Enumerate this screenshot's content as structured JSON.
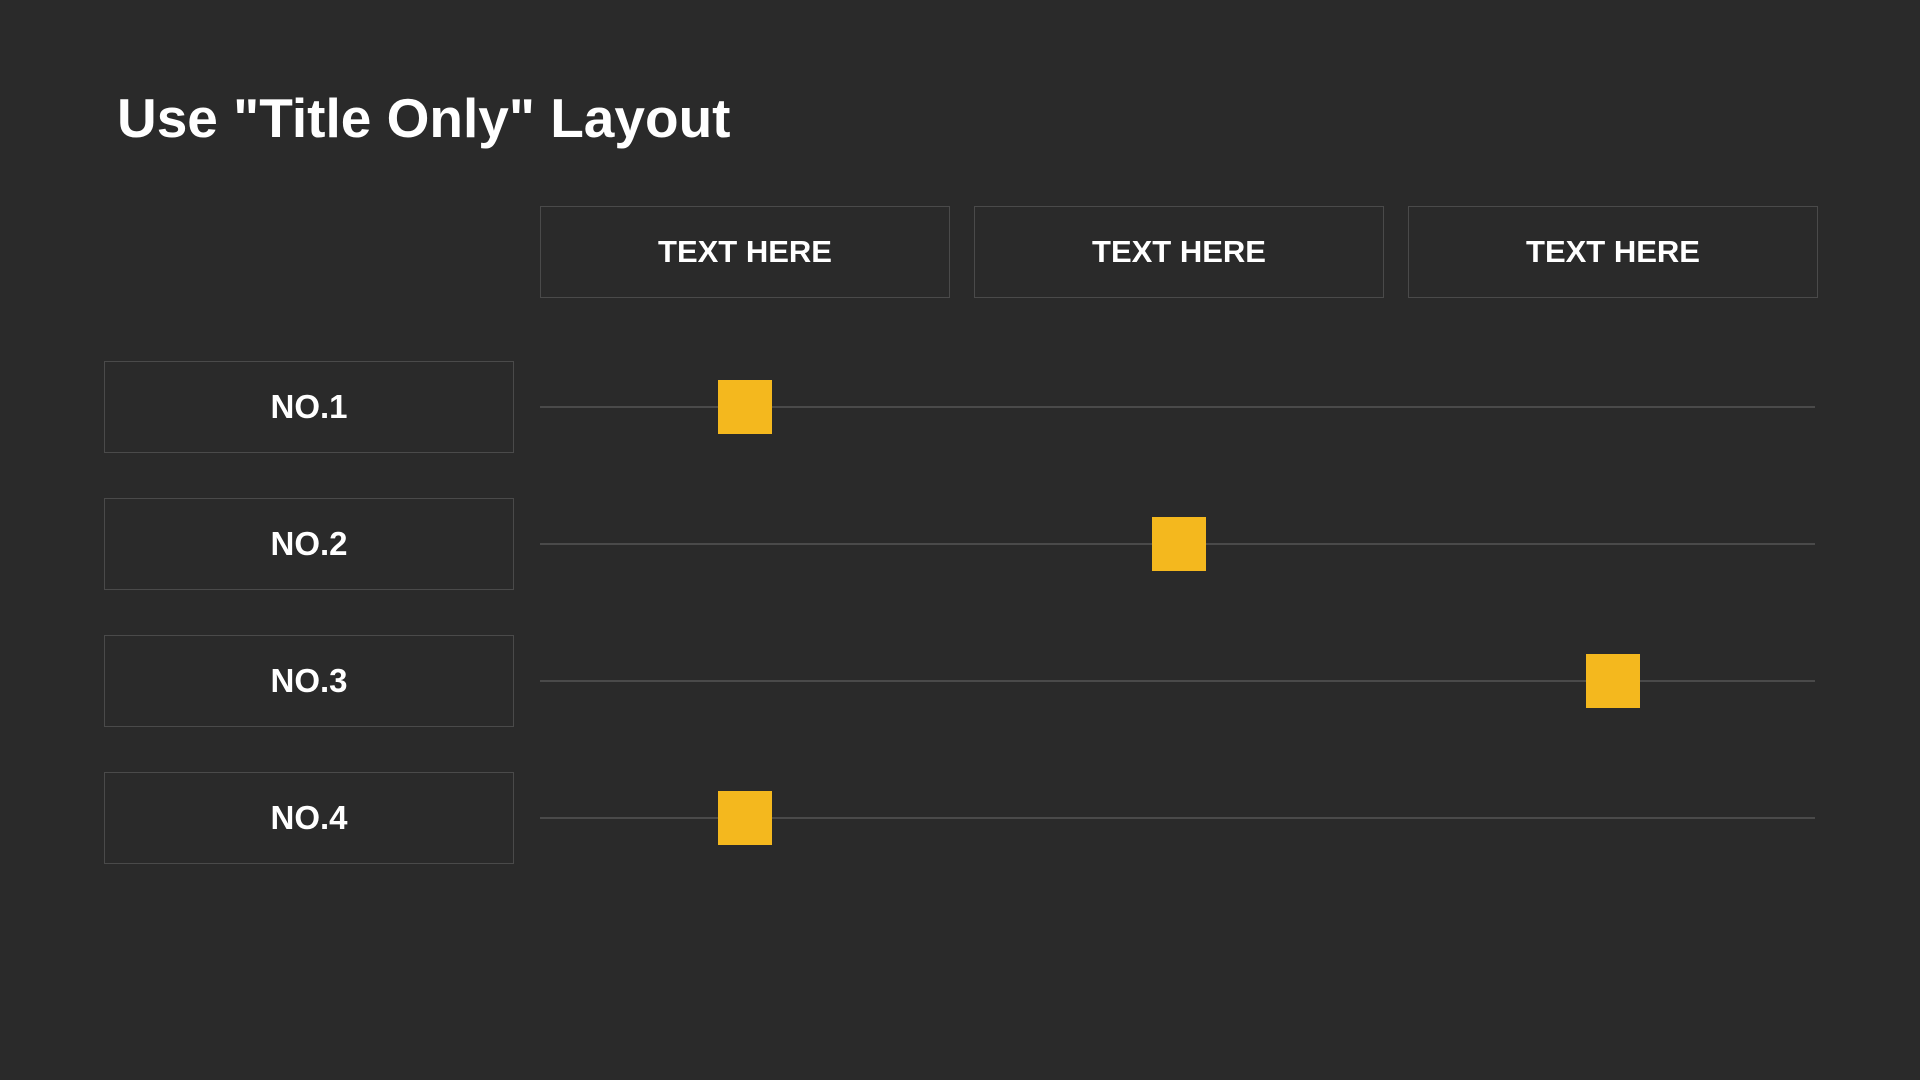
{
  "title": "Use \"Title Only\" Layout",
  "columns": [
    {
      "label": "TEXT HERE"
    },
    {
      "label": "TEXT HERE"
    },
    {
      "label": "TEXT HERE"
    }
  ],
  "rows": [
    {
      "label": "NO.1",
      "marker_col": 0
    },
    {
      "label": "NO.2",
      "marker_col": 1
    },
    {
      "label": "NO.3",
      "marker_col": 2
    },
    {
      "label": "NO.4",
      "marker_col": 0
    }
  ],
  "colors": {
    "background": "#2a2a2a",
    "border": "#4a4a4a",
    "text": "#ffffff",
    "marker": "#f4b81e"
  },
  "chart_data": {
    "type": "table",
    "title": "Use \"Title Only\" Layout",
    "columns": [
      "TEXT HERE",
      "TEXT HERE",
      "TEXT HERE"
    ],
    "rows": [
      "NO.1",
      "NO.2",
      "NO.3",
      "NO.4"
    ],
    "markers": [
      {
        "row": "NO.1",
        "column_index": 0
      },
      {
        "row": "NO.2",
        "column_index": 1
      },
      {
        "row": "NO.3",
        "column_index": 2
      },
      {
        "row": "NO.4",
        "column_index": 0
      }
    ]
  }
}
